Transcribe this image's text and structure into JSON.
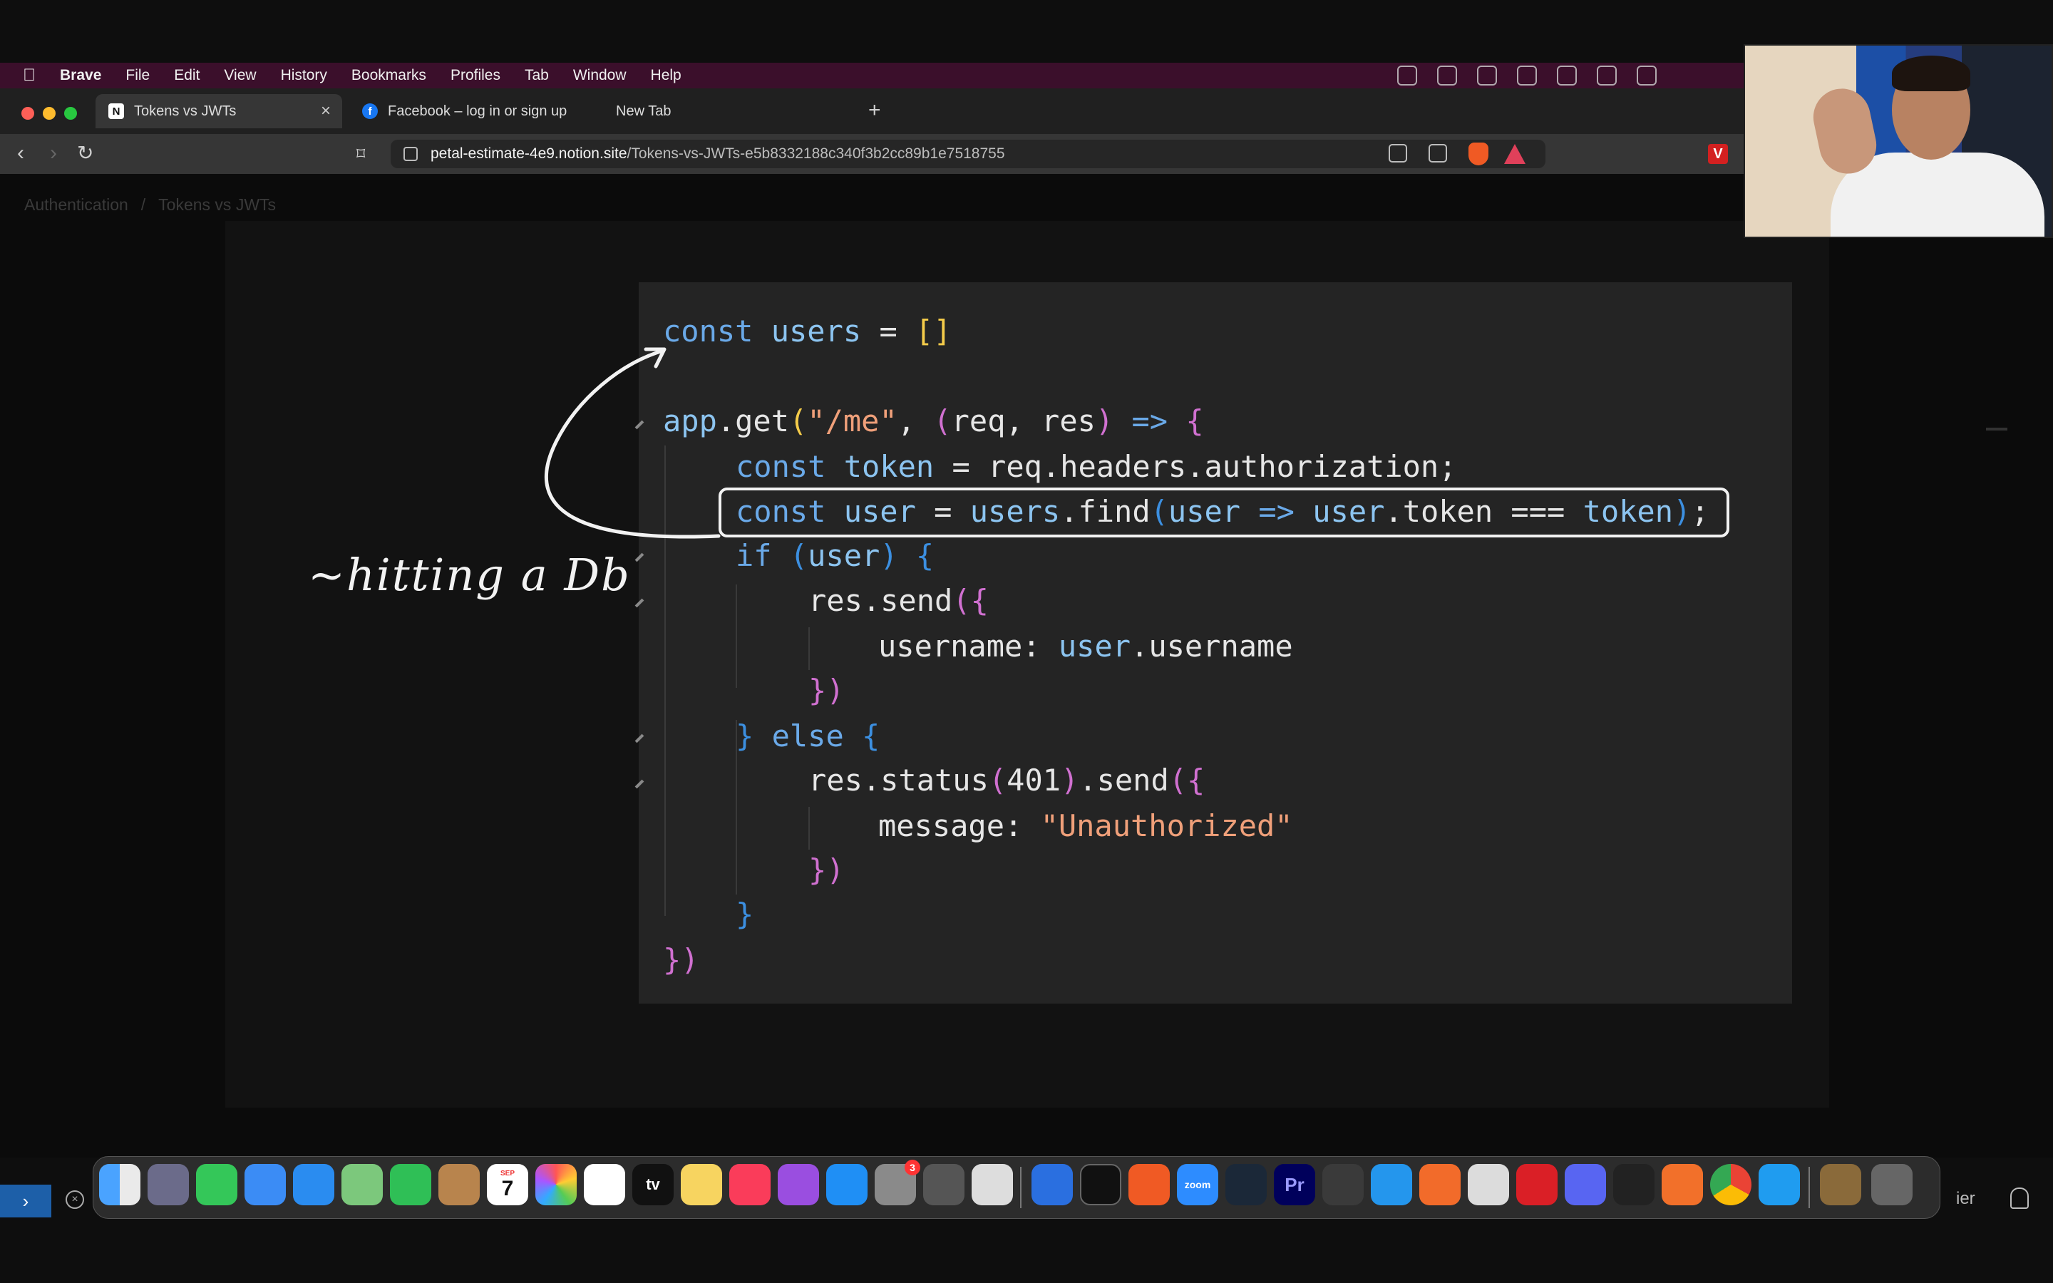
{
  "menubar": {
    "app": "Brave",
    "items": [
      "File",
      "Edit",
      "View",
      "History",
      "Bookmarks",
      "Profiles",
      "Tab",
      "Window",
      "Help"
    ]
  },
  "tabs": [
    {
      "label": "Tokens vs JWTs",
      "favicon": "N",
      "active": true
    },
    {
      "label": "Facebook – log in or sign up",
      "favicon": "f",
      "active": false
    },
    {
      "label": "New Tab",
      "favicon": "",
      "active": false
    }
  ],
  "address": {
    "host": "petal-estimate-4e9.notion.site",
    "path": "/Tokens-vs-JWTs-e5b8332188c340f3b2cc89b1e7518755"
  },
  "breadcrumb": {
    "parent": "Authentication",
    "current": "Tokens vs JWTs"
  },
  "annotation": "~hitting a Db",
  "code": {
    "l1": "const users = []",
    "l2": "app.get(\"/me\", (req, res) => {",
    "l3": "const token = req.headers.authorization;",
    "l4": "const user = users.find(user => user.token === token);",
    "l5": "if (user) {",
    "l6": "res.send({",
    "l7": "username: user.username",
    "l8": "})",
    "l9": "} else {",
    "l10": "res.status(401).send({",
    "l11": "message: \"Unauthorized\"",
    "l12": "})",
    "l13": "}",
    "l14": "})"
  },
  "dock": {
    "calendar_day": "7",
    "calendar_month": "SEP",
    "settings_badge": "3",
    "tv_label": "tv",
    "zoom_label": "zoom",
    "premiere_label": "Pr"
  },
  "statusbar": {
    "right_text": "ier"
  },
  "colors": {
    "menubar_bg": "#3b0f2b",
    "code_bg": "#242424",
    "keyword": "#6aa9e8",
    "string": "#f0a07a"
  }
}
